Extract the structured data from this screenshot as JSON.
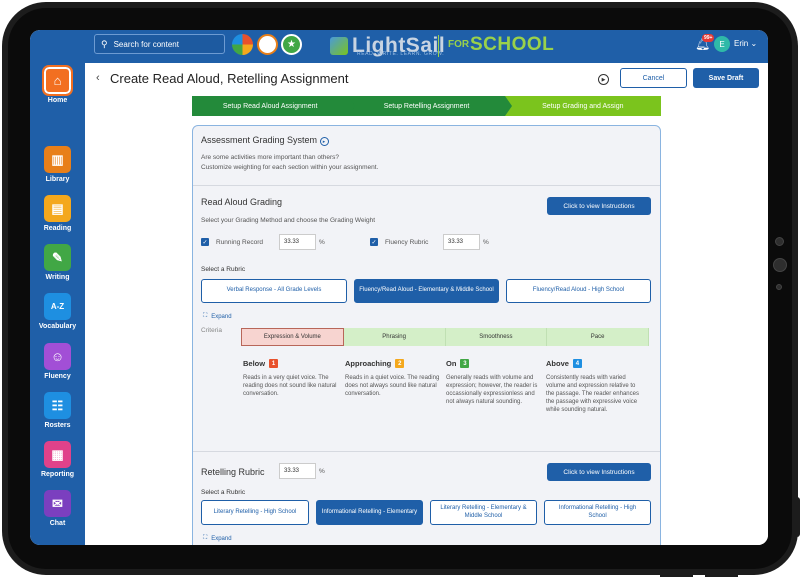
{
  "topbar": {
    "search_placeholder": "Search for content",
    "logo_text": "LightSail",
    "logo_tagline": "READ. WRITE. LEARN. GROW.",
    "logo_for": "FOR",
    "logo_school": "SCHOOL",
    "notifications_badge": "99+",
    "user_initial": "E",
    "user_name": "Erin"
  },
  "sidebar": {
    "items": [
      {
        "label": "Home",
        "icon": "home-icon",
        "color": "#f26f21",
        "glyph": "⌂"
      },
      {
        "label": "Library",
        "icon": "library-icon",
        "color": "#e87f19",
        "glyph": "▥"
      },
      {
        "label": "Reading",
        "icon": "reading-icon",
        "color": "#f4a81d",
        "glyph": "▤"
      },
      {
        "label": "Writing",
        "icon": "writing-icon",
        "color": "#41a745",
        "glyph": "✎"
      },
      {
        "label": "Vocabulary",
        "icon": "vocabulary-icon",
        "color": "#1e8fe1",
        "glyph": "A-Z"
      },
      {
        "label": "Fluency",
        "icon": "fluency-icon",
        "color": "#a24fd6",
        "glyph": "☺"
      },
      {
        "label": "Rosters",
        "icon": "rosters-icon",
        "color": "#1e8fe1",
        "glyph": "☷"
      },
      {
        "label": "Reporting",
        "icon": "reporting-icon",
        "color": "#e0428a",
        "glyph": "▦"
      },
      {
        "label": "Chat",
        "icon": "chat-icon",
        "color": "#7b3fbf",
        "glyph": "✉"
      }
    ]
  },
  "header": {
    "title": "Create Read Aloud, Retelling Assignment",
    "cancel_label": "Cancel",
    "save_label": "Save Draft"
  },
  "steps": [
    "Setup Read Aloud Assignment",
    "Setup Retelling Assignment",
    "Setup Grading and Assign"
  ],
  "assessment": {
    "title": "Assessment Grading System",
    "line1": "Are some activities more important than others?",
    "line2": "Customize weighting for each section within your assignment."
  },
  "read_aloud": {
    "title": "Read Aloud Grading",
    "subtitle": "Select your Grading Method and choose the Grading Weight",
    "instructions_label": "Click to view Instructions",
    "running_record_label": "Running Record",
    "running_record_value": "33.33",
    "fluency_rubric_label": "Fluency Rubric",
    "fluency_rubric_value": "33.33",
    "percent": "%",
    "select_rubric": "Select a Rubric",
    "rubrics": [
      "Verbal Response - All Grade Levels",
      "Fluency/Read Aloud - Elementary & Middle School",
      "Fluency/Read Aloud - High School"
    ],
    "expand_label": "Expand",
    "criteria_label": "Criteria",
    "criteria": [
      "Expression & Volume",
      "Phrasing",
      "Smoothness",
      "Pace"
    ],
    "levels": [
      {
        "name": "Below",
        "num": "1",
        "color": "#e8512c",
        "desc": "Reads in a very quiet voice. The reading does not sound like natural conversation."
      },
      {
        "name": "Approaching",
        "num": "2",
        "color": "#f4a81d",
        "desc": "Reads in a quiet voice. The reading does not always sound like natural conversation."
      },
      {
        "name": "On",
        "num": "3",
        "color": "#41a745",
        "desc": "Generally reads with volume and expression; however, the reader is occassionally expressionless and not always natural sounding."
      },
      {
        "name": "Above",
        "num": "4",
        "color": "#1e8fe1",
        "desc": "Consistently reads with varied volume and expression relative to the passage. The reader enhances the passage with expressive voice while sounding natural."
      }
    ]
  },
  "retelling": {
    "title": "Retelling Rubric",
    "value": "33.33",
    "percent": "%",
    "instructions_label": "Click to view Instructions",
    "select_rubric": "Select a Rubric",
    "rubrics": [
      "Literary Retelling - High School",
      "Informational Retelling - Elementary",
      "Literary Retelling - Elementary & Middle School",
      "Informational Retelling - High School"
    ],
    "expand_label": "Expand"
  }
}
